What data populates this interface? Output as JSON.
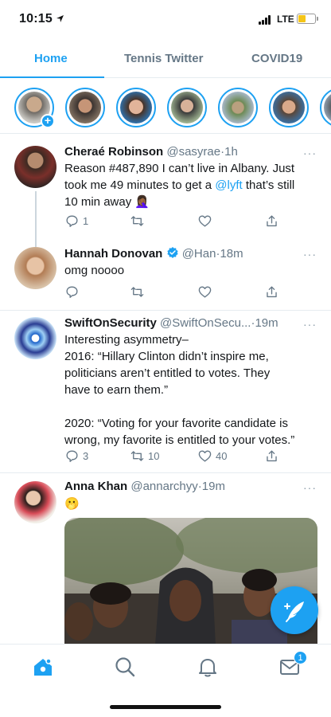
{
  "status_bar": {
    "time": "10:15",
    "network": "LTE",
    "battery_level": 0.45
  },
  "tabs": [
    {
      "label": "Home",
      "active": true
    },
    {
      "label": "Tennis Twitter",
      "active": false
    },
    {
      "label": "COVID19",
      "active": false
    }
  ],
  "fleets": [
    "your-fleet",
    "user-1",
    "user-2",
    "user-3",
    "user-4",
    "user-5",
    "user-6"
  ],
  "tweets": [
    {
      "name": "Cheraé Robinson",
      "handle": "@sasyrae",
      "sep": "·",
      "time": "1h",
      "more": "···",
      "lines": [
        "Reason #487,890 I can’t live in Albany. Just",
        "took me 49 minutes to get a ",
        "10 min away 🤦🏾‍♀️"
      ],
      "mention": "@lyft",
      "line2_tail": " that’s still",
      "reply_count": "1",
      "retweet_count": "",
      "like_count": ""
    },
    {
      "name": "Hannah Donovan",
      "handle": "@Han",
      "sep": "·",
      "time": "18m",
      "more": "···",
      "lines": [
        "omg noooo"
      ],
      "reply_count": "",
      "retweet_count": "",
      "like_count": ""
    },
    {
      "name": "SwiftOnSecurity",
      "handle": "@SwiftOnSecu...",
      "sep": "·",
      "time": "19m",
      "more": "···",
      "lines": [
        "Interesting asymmetry–",
        "2016: “Hillary Clinton didn’t inspire me,",
        "politicians aren’t entitled to votes. They",
        "have to earn them.”",
        "",
        "2020: “Voting for your favorite candidate is",
        "wrong, my favorite is entitled to your votes.”"
      ],
      "reply_count": "3",
      "retweet_count": "10",
      "like_count": "40"
    },
    {
      "name": "Anna Khan",
      "handle": "@annarchyy",
      "sep": "·",
      "time": "19m",
      "more": "···",
      "lines": [
        "🫢"
      ]
    }
  ],
  "bottom_nav": {
    "messages_badge": "1"
  },
  "colors": {
    "accent": "#1da1f2",
    "text": "#14171a",
    "muted": "#657786",
    "divider": "#e6ecf0"
  }
}
